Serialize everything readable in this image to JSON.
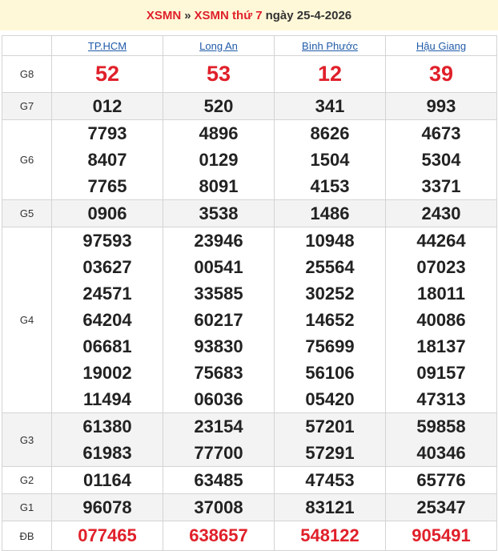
{
  "header": {
    "link1": "XSMN",
    "separator": "»",
    "link2": "XSMN thứ 7",
    "date_text": "ngày 25-4-2026"
  },
  "provinces": [
    "TP.HCM",
    "Long An",
    "Bình Phước",
    "Hậu Giang"
  ],
  "rows": [
    {
      "prize": "G8",
      "cls": "g8",
      "alt": false,
      "values": [
        [
          "52"
        ],
        [
          "53"
        ],
        [
          "12"
        ],
        [
          "39"
        ]
      ]
    },
    {
      "prize": "G7",
      "cls": "g7",
      "alt": true,
      "values": [
        [
          "012"
        ],
        [
          "520"
        ],
        [
          "341"
        ],
        [
          "993"
        ]
      ]
    },
    {
      "prize": "G6",
      "cls": "g6",
      "alt": false,
      "values": [
        [
          "7793",
          "8407",
          "7765"
        ],
        [
          "4896",
          "0129",
          "8091"
        ],
        [
          "8626",
          "1504",
          "4153"
        ],
        [
          "4673",
          "5304",
          "3371"
        ]
      ]
    },
    {
      "prize": "G5",
      "cls": "g5",
      "alt": true,
      "values": [
        [
          "0906"
        ],
        [
          "3538"
        ],
        [
          "1486"
        ],
        [
          "2430"
        ]
      ]
    },
    {
      "prize": "G4",
      "cls": "g4",
      "alt": false,
      "values": [
        [
          "97593",
          "03627",
          "24571",
          "64204",
          "06681",
          "19002",
          "11494"
        ],
        [
          "23946",
          "00541",
          "33585",
          "60217",
          "93830",
          "75683",
          "06036"
        ],
        [
          "10948",
          "25564",
          "30252",
          "14652",
          "75699",
          "56106",
          "05420"
        ],
        [
          "44264",
          "07023",
          "18011",
          "40086",
          "18137",
          "09157",
          "47313"
        ]
      ]
    },
    {
      "prize": "G3",
      "cls": "g3",
      "alt": true,
      "values": [
        [
          "61380",
          "61983"
        ],
        [
          "23154",
          "77700"
        ],
        [
          "57201",
          "57291"
        ],
        [
          "59858",
          "40346"
        ]
      ]
    },
    {
      "prize": "G2",
      "cls": "g2",
      "alt": false,
      "values": [
        [
          "01164"
        ],
        [
          "63485"
        ],
        [
          "47453"
        ],
        [
          "65776"
        ]
      ]
    },
    {
      "prize": "G1",
      "cls": "g1",
      "alt": true,
      "values": [
        [
          "96078"
        ],
        [
          "37008"
        ],
        [
          "83121"
        ],
        [
          "25347"
        ]
      ]
    },
    {
      "prize": "ĐB",
      "cls": "db",
      "alt": false,
      "values": [
        [
          "077465"
        ],
        [
          "638657"
        ],
        [
          "548122"
        ],
        [
          "905491"
        ]
      ]
    }
  ]
}
